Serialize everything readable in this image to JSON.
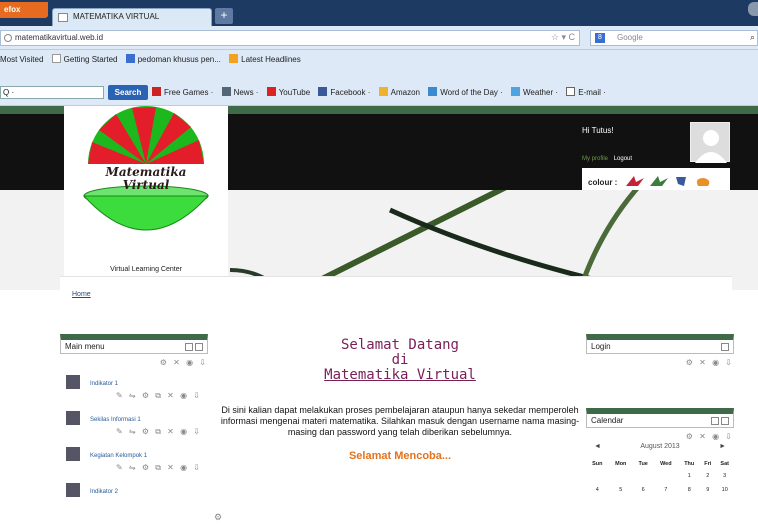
{
  "browser": {
    "menu_button": "efox",
    "tab_title": "MATEMATIKA VIRTUAL",
    "new_tab": "+",
    "url": "matematikavirtual.web.id",
    "search_placeholder": "Google",
    "search_engine_letter": "8"
  },
  "bookmarks": [
    "Most Visited",
    "Getting Started",
    "pedoman khusus pen...",
    "Latest Headlines"
  ],
  "toolbar": {
    "search_value": "Q ·",
    "search_button": "Search",
    "items": [
      "Free Games ·",
      "News ·",
      "YouTube",
      "Facebook ·",
      "Amazon",
      "Word of the Day ·",
      "Weather ·",
      "E-mail ·"
    ]
  },
  "site": {
    "logo_title_line1": "Matematika",
    "logo_title_line2": "Virtual",
    "tagline": "Virtual Learning Center",
    "greeting": "Hi Tutus!",
    "my_profile": "My profile",
    "logout": "Logout",
    "colour_label": "colour :",
    "breadcrumb_home": "Home",
    "colors": {
      "accent_green": "#3e6a47",
      "header_black": "#111111",
      "welcome_purple": "#7a1f57",
      "cheer_orange": "#e4731c"
    }
  },
  "main_menu": {
    "title": "Main menu",
    "items": [
      "Indikator 1",
      "Sekilas Informasi 1",
      "Kegiatan Kelompok 1",
      "Indikator 2"
    ]
  },
  "center": {
    "welcome_line1": "Selamat Datang",
    "welcome_line2": "di",
    "welcome_line3": "Matematika Virtual",
    "paragraph": "Di sini kalian dapat melakukan proses pembelajaran ataupun hanya sekedar memperoleh informasi mengenai materi matematika. Silahkan masuk dengan username nama masing-masing dan password yang telah diberikan sebelumnya.",
    "cheer": "Selamat Mencoba..."
  },
  "login": {
    "title": "Login"
  },
  "calendar": {
    "title": "Calendar",
    "month": "August 2013",
    "prev": "◄",
    "next": "►",
    "days": [
      "Sun",
      "Mon",
      "Tue",
      "Wed",
      "Thu",
      "Fri",
      "Sat"
    ],
    "week1": [
      "",
      "",
      "",
      "",
      "1",
      "2",
      "3"
    ],
    "week2": [
      "4",
      "5",
      "6",
      "7",
      "8",
      "9",
      "10"
    ]
  }
}
